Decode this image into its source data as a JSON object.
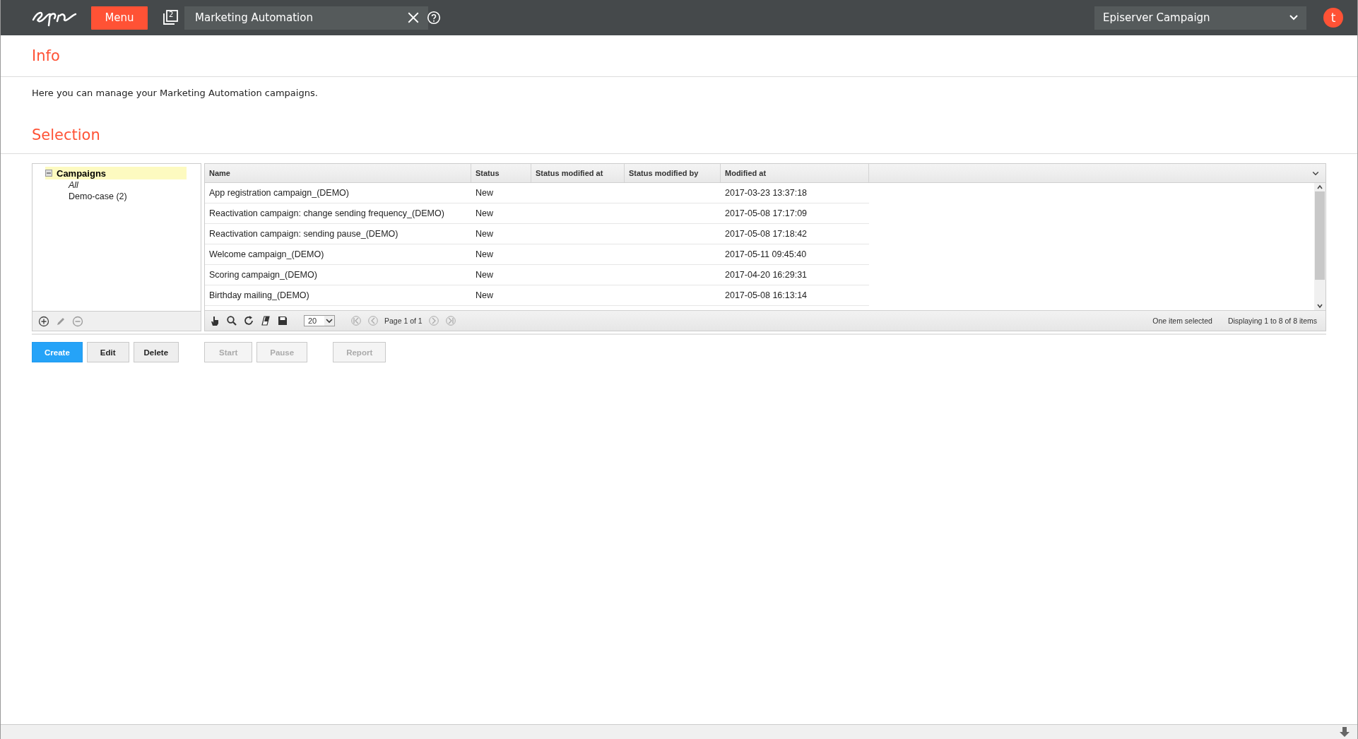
{
  "topbar": {
    "menu_label": "Menu",
    "tab_count": "2",
    "tab_title": "Marketing Automation",
    "product": "Episerver Campaign",
    "avatar": "t"
  },
  "info": {
    "title": "Info",
    "text": "Here you can manage your Marketing Automation campaigns."
  },
  "selection": {
    "title": "Selection"
  },
  "tree": {
    "label": "Campaigns",
    "expanded": true,
    "selected": true,
    "children": [
      {
        "label": "All",
        "italic": true
      },
      {
        "label": "Demo-case (2)",
        "italic": false
      }
    ]
  },
  "table": {
    "columns": [
      "Name",
      "Status",
      "Status modified at",
      "Status modified by",
      "Modified at"
    ],
    "rows": [
      [
        "App registration campaign_(DEMO)",
        "New",
        "",
        "",
        "2017-03-23 13:37:18"
      ],
      [
        "Reactivation campaign: change sending frequency_(DEMO)",
        "New",
        "",
        "",
        "2017-05-08 17:17:09"
      ],
      [
        "Reactivation campaign: sending pause_(DEMO)",
        "New",
        "",
        "",
        "2017-05-08 17:18:42"
      ],
      [
        "Welcome campaign_(DEMO)",
        "New",
        "",
        "",
        "2017-05-11 09:45:40"
      ],
      [
        "Scoring campaign_(DEMO)",
        "New",
        "",
        "",
        "2017-04-20 16:29:31"
      ],
      [
        "Birthday mailing_(DEMO)",
        "New",
        "",
        "",
        "2017-05-08 16:13:14"
      ]
    ],
    "page_size": "20",
    "page_info": "Page 1 of 1",
    "selection_info": "One item selected",
    "display_info": "Displaying 1 to 8 of 8 items"
  },
  "buttons": [
    {
      "label": "Create",
      "kind": "primary",
      "disabled": false
    },
    {
      "label": "Edit",
      "kind": "default",
      "disabled": false
    },
    {
      "label": "Delete",
      "kind": "default",
      "disabled": false
    },
    {
      "label": "Start",
      "kind": "default",
      "disabled": true
    },
    {
      "label": "Pause",
      "kind": "default",
      "disabled": true
    },
    {
      "label": "Report",
      "kind": "default",
      "disabled": true
    }
  ]
}
